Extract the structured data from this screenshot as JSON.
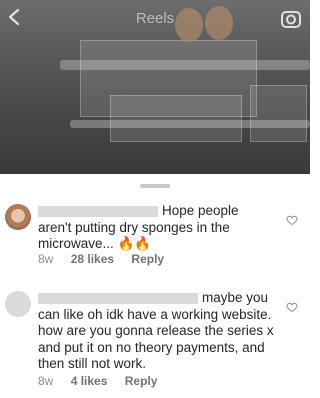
{
  "header": {
    "title": "Reels"
  },
  "comments": [
    {
      "text_line1": "Hope people",
      "text_rest": "aren't putting dry sponges in the microwave... 🔥🔥",
      "age": "8w",
      "likes": "28 likes",
      "reply": "Reply"
    },
    {
      "text_line1": "maybe you",
      "text_rest": "can like oh idk have a working website. how are you gonna release the series x and put it on no theory payments, and then still not work.",
      "age": "8w",
      "likes": "4 likes",
      "reply": "Reply"
    }
  ],
  "icons": {
    "back": "chevron-left-icon",
    "camera": "camera-icon",
    "like": "heart-outline-icon"
  },
  "colors": {
    "text": "#262626",
    "muted": "#8e8e8e",
    "sheet": "#ffffff"
  }
}
